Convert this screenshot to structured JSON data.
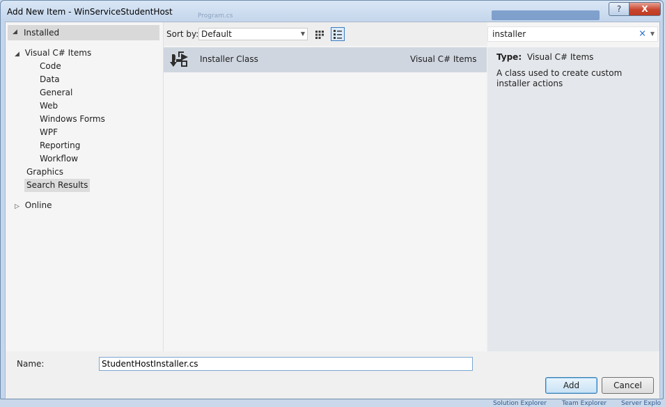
{
  "window": {
    "title": "Add New Item - WinServiceStudentHost",
    "help_label": "?",
    "close_label": "X",
    "background_tab": "Program.cs",
    "background_panel": "Solution Explorer"
  },
  "tree": {
    "installed": "Installed",
    "root": "Visual C# Items",
    "children": [
      "Code",
      "Data",
      "General",
      "Web",
      "Windows Forms",
      "WPF",
      "Reporting",
      "Workflow"
    ],
    "graphics": "Graphics",
    "search_results": "Search Results",
    "online": "Online"
  },
  "sort": {
    "label": "Sort by:",
    "value": "Default"
  },
  "items": [
    {
      "name": "Installer Class",
      "category": "Visual C# Items",
      "icon": "installer-class-icon"
    }
  ],
  "search": {
    "value": "installer",
    "clear_label": "×"
  },
  "details": {
    "type_label": "Type:",
    "type_value": "Visual C# Items",
    "description": "A class used to create custom installer actions"
  },
  "bottom": {
    "name_label": "Name:",
    "name_value": "StudentHostInstaller.cs",
    "add_label": "Add",
    "cancel_label": "Cancel"
  },
  "taskbar": {
    "tabs": [
      "Solution Explorer",
      "Team Explorer",
      "Server Explo"
    ]
  },
  "colors": {
    "selected_row": "#cfd6e0",
    "details_background": "#e4e7eb",
    "close_button": "#c8452e",
    "search_clear": "#1c69c9"
  }
}
